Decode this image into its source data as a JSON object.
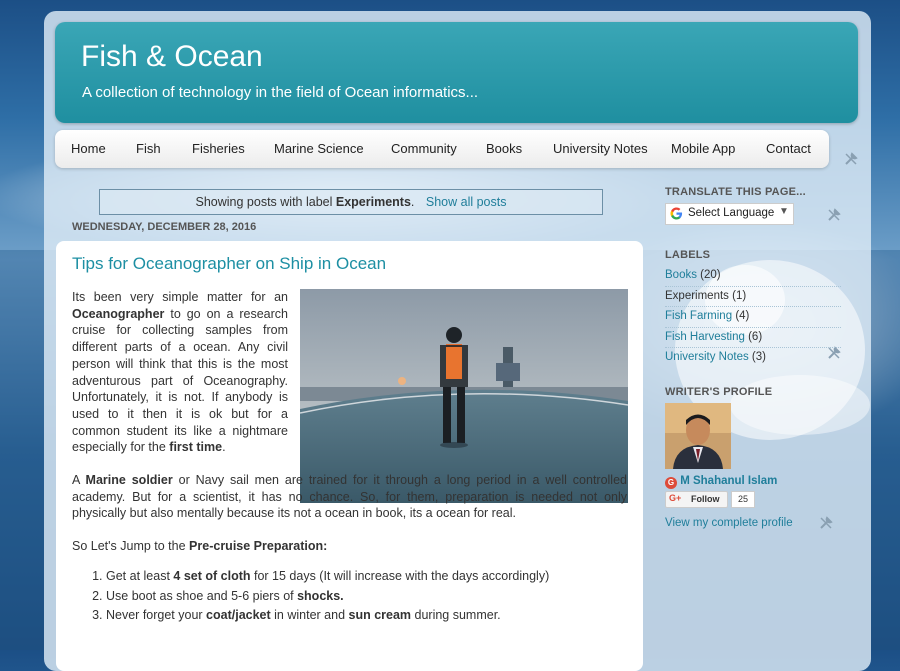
{
  "header": {
    "title": "Fish & Ocean",
    "description": "A collection of technology in the field of Ocean informatics..."
  },
  "nav": {
    "items": [
      "Home",
      "Fish",
      "Fisheries",
      "Marine Science",
      "Community",
      "Books",
      "University Notes",
      "Mobile App",
      "Contact"
    ]
  },
  "status": {
    "prefix": "Showing posts with label",
    "label": "Experiments",
    "suffix": ".",
    "show_all": "Show all posts"
  },
  "post": {
    "date": "WEDNESDAY, DECEMBER 28, 2016",
    "title": "Tips for Oceanographer on Ship in Ocean",
    "p1_a": "Its been very simple matter for an ",
    "p1_b": "Oceanographer",
    "p1_c": " to go on a research cruise for collecting samples from different parts of a ocean. Any civil person will think that this is the most adventurous part of Oceanography. Unfortunately, it is not. If anybody is used to it then it is ok but for a common student its like a nightmare especially for the ",
    "p1_d": "first time",
    "p1_e": ".",
    "p2_a": "A ",
    "p2_b": "Marine soldier",
    "p2_c": " or  Navy sail men are trained for it through a long period in a well controlled academy. But for a scientist, it has no chance. So, for them, preparation is needed not only physically but also mentally because its not a ocean in book, its a ocean for real.",
    "p3_a": "So Let's Jump to the ",
    "p3_b": "Pre-cruise Preparation:",
    "list": [
      {
        "a": "Get at least ",
        "b": "4 set of cloth",
        "c": " for 15 days (It will increase with the days accordingly)"
      },
      {
        "a": "Use boot as shoe and 5-6 piers of ",
        "b": "shocks.",
        "c": ""
      },
      {
        "a": "Never forget your ",
        "b": "coat/jacket",
        "c": " in winter and ",
        "d": "sun cream",
        "e": " during summer."
      }
    ]
  },
  "sidebar": {
    "translate_heading": "TRANSLATE THIS PAGE...",
    "translate_select": "Select Language",
    "labels_heading": "LABELS",
    "labels": [
      {
        "name": "Books",
        "count": "(20)"
      },
      {
        "name": "Experiments",
        "count": "(1)"
      },
      {
        "name": "Fish Farming",
        "count": "(4)"
      },
      {
        "name": "Fish Harvesting",
        "count": "(6)"
      },
      {
        "name": "University Notes",
        "count": "(3)"
      }
    ],
    "profile_heading": "WRITER'S PROFILE",
    "profile_name": "M Shahanul Islam",
    "follow_label": "Follow",
    "follow_count": "25",
    "view_profile": "View my complete profile"
  },
  "colors": {
    "header_teal": "#1f8fa0",
    "link": "#1f7e9a",
    "title_link": "#1d8fa3"
  }
}
